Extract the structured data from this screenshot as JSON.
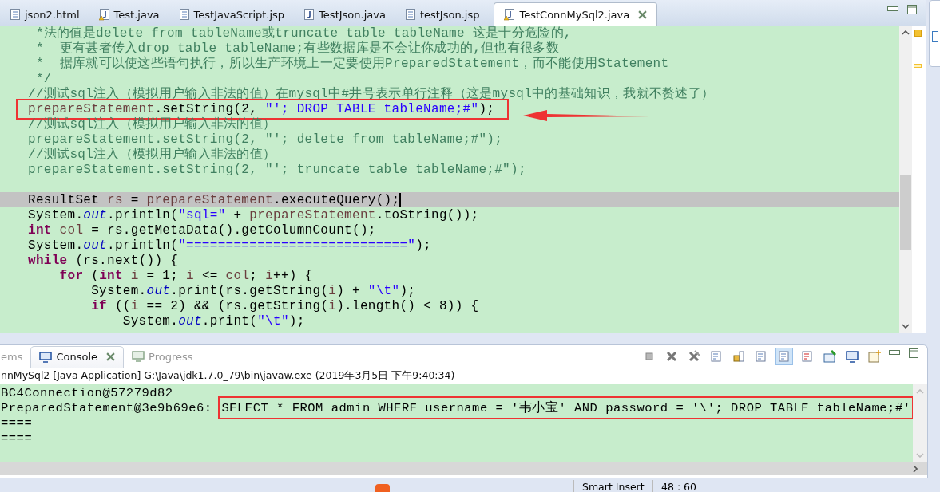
{
  "editor_tabs": [
    {
      "label": "json2.html",
      "kind": "page",
      "selected": false
    },
    {
      "label": "Test.java",
      "kind": "java-warning",
      "selected": false
    },
    {
      "label": "TestJavaScript.jsp",
      "kind": "page",
      "selected": false
    },
    {
      "label": "TestJson.java",
      "kind": "java",
      "selected": false
    },
    {
      "label": "testJson.jsp",
      "kind": "page",
      "selected": false
    },
    {
      "label": "TestConnMySql2.java",
      "kind": "java-warning",
      "selected": true
    }
  ],
  "code_lines": [
    {
      "current": false,
      "highlighted": false,
      "tokens": [
        {
          "kind": "comment",
          "text": " *法的值是delete from tableName或truncate table tableName 这是十分危险的,"
        }
      ]
    },
    {
      "current": false,
      "highlighted": false,
      "tokens": [
        {
          "kind": "comment",
          "text": " *  更有甚者传入drop table tableName;有些数据库是不会让你成功的,但也有很多数"
        }
      ]
    },
    {
      "current": false,
      "highlighted": false,
      "tokens": [
        {
          "kind": "comment",
          "text": " *  据库就可以使这些语句执行，所以生产环境上一定要使用PreparedStatement，而不能使用Statement"
        }
      ]
    },
    {
      "current": false,
      "highlighted": false,
      "tokens": [
        {
          "kind": "comment",
          "text": " */"
        }
      ]
    },
    {
      "current": false,
      "highlighted": false,
      "tokens": [
        {
          "kind": "comment",
          "text": "//测试sql注入（模拟用户输入非法的值）在mysql中#井号表示单行注释（这是mysql中的基础知识，我就不赘述了）"
        }
      ]
    },
    {
      "current": false,
      "highlighted": true,
      "tokens": [
        {
          "kind": "local",
          "text": "prepareStatement"
        },
        {
          "kind": "plain",
          "text": ".setString(2, "
        },
        {
          "kind": "string",
          "text": "\"'; DROP TABLE tableName;#\""
        },
        {
          "kind": "plain",
          "text": ");"
        }
      ]
    },
    {
      "current": false,
      "highlighted": false,
      "tokens": [
        {
          "kind": "comment",
          "text": "//测试sql注入（模拟用户输入非法的值）"
        }
      ]
    },
    {
      "current": false,
      "highlighted": false,
      "tokens": [
        {
          "kind": "comment",
          "text": "prepareStatement.setString(2, \"'; delete from tableName;#\");"
        }
      ]
    },
    {
      "current": false,
      "highlighted": false,
      "tokens": [
        {
          "kind": "comment",
          "text": "//测试sql注入（模拟用户输入非法的值）"
        }
      ]
    },
    {
      "current": false,
      "highlighted": false,
      "tokens": [
        {
          "kind": "comment",
          "text": "prepareStatement.setString(2, \"'; truncate table tableName;#\");"
        }
      ]
    },
    {
      "current": false
    },
    {
      "current": true,
      "highlighted": false,
      "tokens": [
        {
          "kind": "plain",
          "text": "ResultSet "
        },
        {
          "kind": "local",
          "text": "rs"
        },
        {
          "kind": "plain",
          "text": " = "
        },
        {
          "kind": "local",
          "text": "prepareStatement"
        },
        {
          "kind": "plain",
          "text": ".executeQuery();"
        }
      ]
    },
    {
      "current": false,
      "highlighted": false,
      "tokens": [
        {
          "kind": "plain",
          "text": "System."
        },
        {
          "kind": "field",
          "text": "out"
        },
        {
          "kind": "plain",
          "text": ".println("
        },
        {
          "kind": "string",
          "text": "\"sql=\""
        },
        {
          "kind": "plain",
          "text": " + "
        },
        {
          "kind": "local",
          "text": "prepareStatement"
        },
        {
          "kind": "plain",
          "text": ".toString());"
        }
      ]
    },
    {
      "current": false,
      "highlighted": false,
      "tokens": [
        {
          "kind": "keyword",
          "text": "int"
        },
        {
          "kind": "local",
          "text": " col"
        },
        {
          "kind": "plain",
          "text": " = rs.getMetaData().getColumnCount();"
        }
      ]
    },
    {
      "current": false,
      "highlighted": false,
      "tokens": [
        {
          "kind": "plain",
          "text": "System."
        },
        {
          "kind": "field",
          "text": "out"
        },
        {
          "kind": "plain",
          "text": ".println("
        },
        {
          "kind": "string",
          "text": "\"============================\""
        },
        {
          "kind": "plain",
          "text": ");"
        }
      ]
    },
    {
      "current": false,
      "highlighted": false,
      "tokens": [
        {
          "kind": "keyword",
          "text": "while"
        },
        {
          "kind": "plain",
          "text": " (rs.next()) {"
        }
      ]
    },
    {
      "current": false,
      "highlighted": false,
      "tokens": [
        {
          "kind": "keyword",
          "text": "    for"
        },
        {
          "kind": "plain",
          "text": " ("
        },
        {
          "kind": "keyword",
          "text": "int"
        },
        {
          "kind": "local",
          "text": " i"
        },
        {
          "kind": "plain",
          "text": " = 1; "
        },
        {
          "kind": "local",
          "text": "i"
        },
        {
          "kind": "plain",
          "text": " <= "
        },
        {
          "kind": "local",
          "text": "col"
        },
        {
          "kind": "plain",
          "text": "; "
        },
        {
          "kind": "local",
          "text": "i"
        },
        {
          "kind": "plain",
          "text": "++) {"
        }
      ]
    },
    {
      "current": false,
      "highlighted": false,
      "tokens": [
        {
          "kind": "plain",
          "text": "        System."
        },
        {
          "kind": "field",
          "text": "out"
        },
        {
          "kind": "plain",
          "text": ".print(rs.getString("
        },
        {
          "kind": "local",
          "text": "i"
        },
        {
          "kind": "plain",
          "text": ") + "
        },
        {
          "kind": "string",
          "text": "\"\\t\""
        },
        {
          "kind": "plain",
          "text": ");"
        }
      ]
    },
    {
      "current": false,
      "highlighted": false,
      "tokens": [
        {
          "kind": "keyword",
          "text": "        if"
        },
        {
          "kind": "plain",
          "text": " (("
        },
        {
          "kind": "local",
          "text": "i"
        },
        {
          "kind": "plain",
          "text": " == 2) && (rs.getString("
        },
        {
          "kind": "local",
          "text": "i"
        },
        {
          "kind": "plain",
          "text": ").length() < 8)) {"
        }
      ]
    },
    {
      "current": false,
      "highlighted": false,
      "tokens": [
        {
          "kind": "plain",
          "text": "            System."
        },
        {
          "kind": "field",
          "text": "out"
        },
        {
          "kind": "plain",
          "text": ".print("
        },
        {
          "kind": "string",
          "text": "\"\\t\""
        },
        {
          "kind": "plain",
          "text": ");"
        }
      ]
    }
  ],
  "console": {
    "tabs": [
      {
        "label": "ems",
        "selected": false
      },
      {
        "label": "Console",
        "selected": true
      },
      {
        "label": "Progress",
        "selected": false
      }
    ],
    "launch_label": "nnMySql2 [Java Application] G:\\Java\\jdk1.7.0_79\\bin\\javaw.exe (2019年3月5日 下午9:40:34)",
    "lines": [
      {
        "segments": [
          {
            "text": "BC4Connection@57279d82",
            "highlighted": false
          }
        ]
      },
      {
        "segments": [
          {
            "text": "PreparedStatement@3e9b69e6: ",
            "highlighted": false
          },
          {
            "text": "SELECT * FROM admin WHERE username = '韦小宝' AND password = '\\'; DROP TABLE tableName;#'",
            "highlighted": true
          }
        ]
      },
      {
        "segments": [
          {
            "text": "====",
            "highlighted": false
          }
        ]
      },
      {
        "segments": [
          {
            "text": "====",
            "highlighted": false
          }
        ]
      }
    ]
  },
  "status_bar": {
    "insert_mode": "Smart Insert",
    "position": "48 : 60"
  }
}
